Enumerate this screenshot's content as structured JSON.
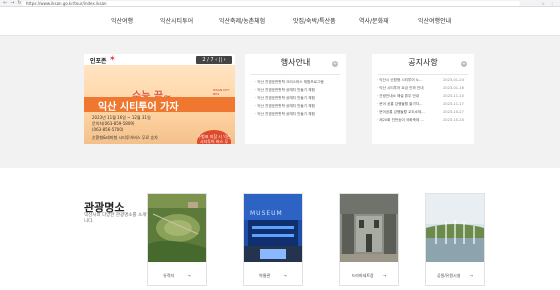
{
  "browser": {
    "url": "https://www.iksan.go.kr/tour/index.iksan",
    "nav_icons": [
      "←",
      "→",
      "↻"
    ],
    "action_icons": "☆ ⋮"
  },
  "gnb": {
    "items": [
      "익산여행",
      "익산시티투어",
      "익산축제/농촌체험",
      "맛집/숙박/특산품",
      "역사/문화재",
      "익산여행안내"
    ]
  },
  "banner": {
    "tag": "인포존",
    "pager": "2 / 7  ‹  ||  ›",
    "headline1": "수능 끝~",
    "headline2": "익산 시티투어 가자",
    "bus_label": "IKSAN CITY BUS",
    "lines": [
      "2023년 11월 16일 ~ 12월 31일",
      "문의처(063-859-5809)",
      "(063-856-5700)",
      "순환형&테마형 시티투어버스 무료 승차"
    ],
    "circle_text": "수험표 지참 시 익산 시티투어 버스 무료!!!"
  },
  "events": {
    "title": "행사안내",
    "items": [
      "· 익산 천경호판판학 크리스마스 체험프로그램",
      "· 익산 천경호판판학 공예치 만들기 체험",
      "· 익산 천경호판판학 공예치 만들기 체험",
      "· 익산 천경호판판학 공예치 만들기 체험",
      "· 익산 천경호판판학 공예치 만들기 체험"
    ]
  },
  "notices": {
    "title": "공지사항",
    "items": [
      {
        "text": "· 익산시 순환형 시티투어 노...",
        "date": "2023-01-24"
      },
      {
        "text": "· 익산 시티투어 요금 인하 안내",
        "date": "2023-01-16"
      },
      {
        "text": "· 관광안내소 해설 휴무 안내",
        "date": "2023-11-10"
      },
      {
        "text": "· 문어 공룡 강행돌활 출가자...",
        "date": "2023-11-17"
      },
      {
        "text": "· 문어공룡 강행돌활 교도소체...",
        "date": "2023-10-27"
      },
      {
        "text": "· 제20회 천만송이 국화축제 ...",
        "date": "2023-10-20"
      }
    ]
  },
  "tour": {
    "title": "관광명소",
    "desc": "익산시의 다양한 관광명소를 소개합니다.",
    "cards": [
      {
        "label": "유적지",
        "arrow": "→"
      },
      {
        "label": "박물관",
        "arrow": "→"
      },
      {
        "label": "드라마세트장",
        "arrow": "→"
      },
      {
        "label": "공원/유원시설",
        "arrow": "→"
      }
    ],
    "museum_sign": "MUSEUM"
  },
  "colors": {
    "accent": "#f0772f",
    "gray_bg": "#f2f2f2",
    "banner_red": "#e04a2c"
  }
}
